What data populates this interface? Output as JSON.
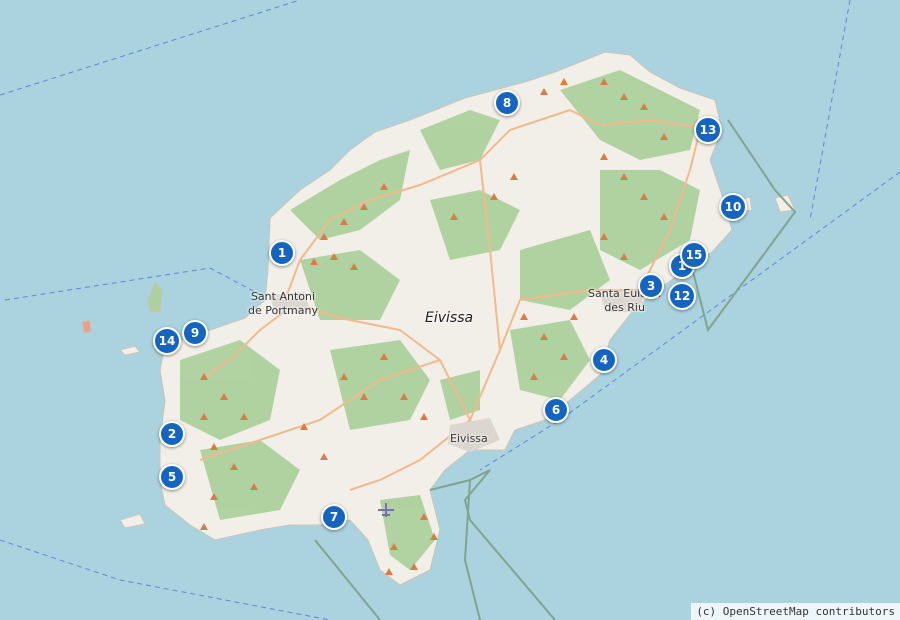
{
  "map": {
    "colors": {
      "sea": "#aad3df",
      "land": "#f2efe9",
      "forest": "#add19e",
      "road": "#f3b98a",
      "boundary": "#7fa58e",
      "marker": "#1565c0",
      "peak": "#d97c4a"
    },
    "places": {
      "eivissa_region": "Eivissa",
      "eivissa_town": "Eivissa",
      "sant_antoni": "Sant Antoni\nde Portmany",
      "santa_eularia": "Santa Eulària\ndes Riu"
    },
    "markers": [
      {
        "label": "1"
      },
      {
        "label": "2"
      },
      {
        "label": "3"
      },
      {
        "label": "4"
      },
      {
        "label": "5"
      },
      {
        "label": "6"
      },
      {
        "label": "7"
      },
      {
        "label": "8"
      },
      {
        "label": "9"
      },
      {
        "label": "10"
      },
      {
        "label": "1"
      },
      {
        "label": "12"
      },
      {
        "label": "13"
      },
      {
        "label": "14"
      },
      {
        "label": "15"
      }
    ],
    "attribution": "(c) OpenStreetMap contributors"
  }
}
